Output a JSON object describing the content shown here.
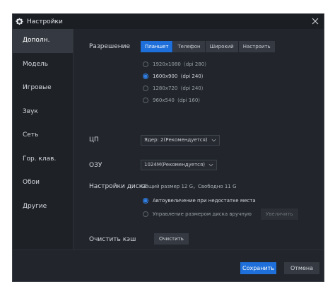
{
  "window": {
    "title": "Настройки",
    "icon": "gear-icon",
    "close_icon": "close-icon"
  },
  "sidebar": {
    "items": [
      {
        "label": "Дополн.",
        "active": true
      },
      {
        "label": "Модель",
        "active": false
      },
      {
        "label": "Игровые",
        "active": false
      },
      {
        "label": "Звук",
        "active": false
      },
      {
        "label": "Сеть",
        "active": false
      },
      {
        "label": "Гор. клав.",
        "active": false
      },
      {
        "label": "Обои",
        "active": false
      },
      {
        "label": "Другие",
        "active": false
      }
    ]
  },
  "resolution": {
    "label": "Разрешение",
    "tabs": [
      {
        "label": "Планшет",
        "active": true
      },
      {
        "label": "Телефон",
        "active": false
      },
      {
        "label": "Широкий",
        "active": false
      },
      {
        "label": "Настроить",
        "active": false
      }
    ],
    "options": [
      {
        "label": "1920x1080（dpi 280）",
        "checked": false
      },
      {
        "label": "1600x900（dpi 240）",
        "checked": true
      },
      {
        "label": "1280x720（dpi 240）",
        "checked": false
      },
      {
        "label": "960x540（dpi 160）",
        "checked": false
      }
    ]
  },
  "cpu": {
    "label": "ЦП",
    "value": "Ядер: 2(Рекомендуется)"
  },
  "ram": {
    "label": "ОЗУ",
    "value": "1024M(Рекомендуется)"
  },
  "disk": {
    "label": "Настройки диска",
    "info": "Общий размер 12 G，Свободно 11 G",
    "options": [
      {
        "label": "Автоувеличение при недостатке места",
        "checked": true
      },
      {
        "label": "Управление размером диска вручную",
        "checked": false
      }
    ],
    "increase_label": "Увеличить"
  },
  "cache": {
    "label": "Очистить кэш",
    "button": "Очистить"
  },
  "footer": {
    "save": "Сохранить",
    "cancel": "Отмена"
  },
  "colors": {
    "accent": "#1e6fd9",
    "background": "#22262c",
    "sidebar": "#1e2126"
  }
}
